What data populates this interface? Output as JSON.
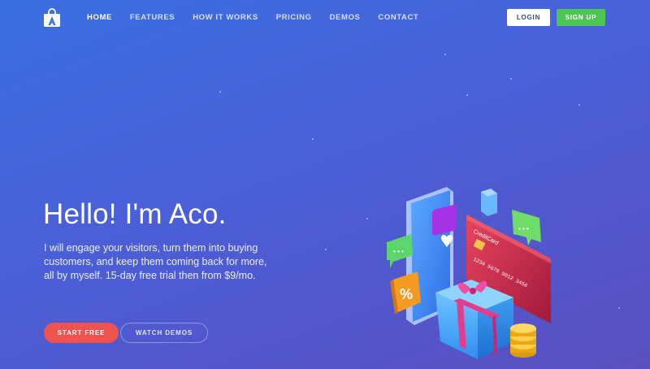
{
  "header": {
    "logo_icon": "shopping-bag-icon",
    "nav": [
      {
        "label": "HOME",
        "active": true
      },
      {
        "label": "FEATURES",
        "active": false
      },
      {
        "label": "HOW IT WORKS",
        "active": false
      },
      {
        "label": "PRICING",
        "active": false
      },
      {
        "label": "DEMOS",
        "active": false
      },
      {
        "label": "CONTACT",
        "active": false
      }
    ],
    "login_label": "LOGIN",
    "signup_label": "SIGN UP"
  },
  "hero": {
    "title": "Hello! I'm Aco.",
    "description": "I will engage your visitors, turn them into buying customers, and keep them coming back for more, all by myself. 15-day free trial then from $9/mo.",
    "start_label": "START FREE",
    "watch_label": "WATCH DEMOS"
  },
  "illustration": {
    "card_brand": "CreditCard",
    "card_number": "1234 5678 9012 3456",
    "percent_symbol": "%",
    "chat_dots": "• • •"
  },
  "colors": {
    "background_start": "#3a6fe0",
    "background_end": "#5a4fbf",
    "signup_green": "#4cc552",
    "start_red": "#ef5350"
  }
}
